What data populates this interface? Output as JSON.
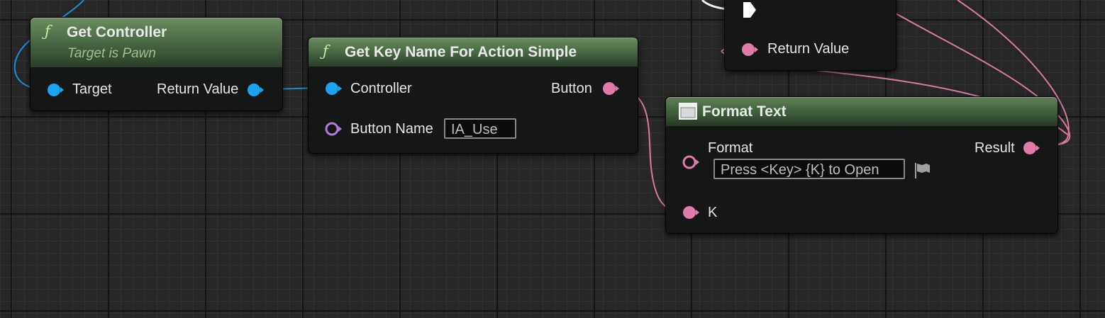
{
  "graph": {
    "nodes": {
      "get_controller": {
        "title": "Get Controller",
        "subtitle": "Target is Pawn",
        "input_pin": "Target",
        "output_pin": "Return Value"
      },
      "get_key_name": {
        "title": "Get Key Name For Action Simple",
        "input_controller": "Controller",
        "input_button_name": "Button Name",
        "button_name_value": "IA_Use",
        "output_pin": "Button"
      },
      "top_node": {
        "output_pin": "Return Value"
      },
      "format_text": {
        "title": "Format Text",
        "input_format": "Format",
        "format_value": "Press <Key> {K} to Open",
        "input_k": "K",
        "output_pin": "Result"
      }
    },
    "colors": {
      "object_pin": "#1aa3f0",
      "text_pin": "#e07aa8",
      "name_pin": "#b07ae0",
      "header_green": "#4c6b47"
    }
  }
}
